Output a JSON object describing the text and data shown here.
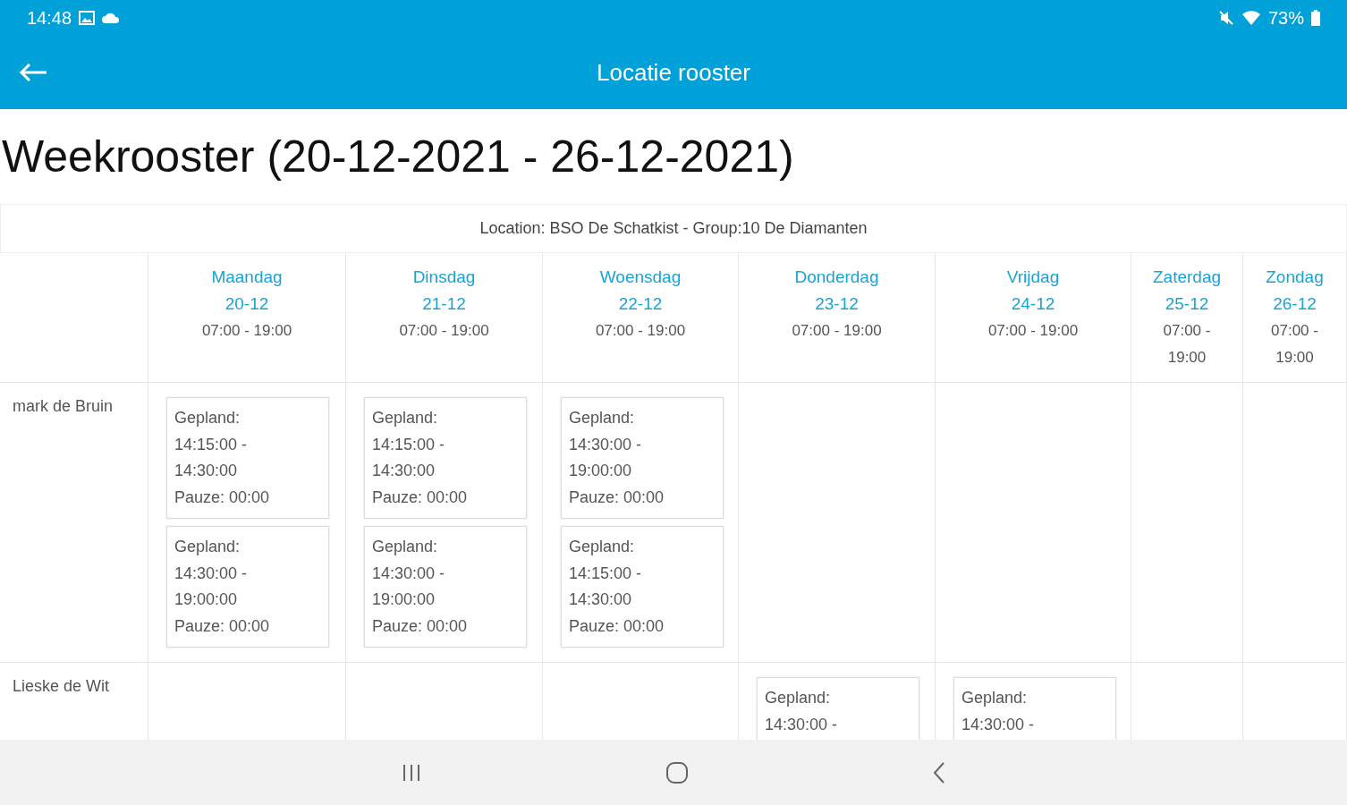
{
  "status_bar": {
    "time": "14:48",
    "battery": "73%"
  },
  "toolbar": {
    "title": "Locatie rooster"
  },
  "heading": "Weekrooster (20-12-2021 - 26-12-2021)",
  "location": "Location: BSO De Schatkist - Group:10 De Diamanten",
  "days": [
    {
      "name": "Maandag",
      "date": "20-12",
      "hours": "07:00 - 19:00"
    },
    {
      "name": "Dinsdag",
      "date": "21-12",
      "hours": "07:00 - 19:00"
    },
    {
      "name": "Woensdag",
      "date": "22-12",
      "hours": "07:00 - 19:00"
    },
    {
      "name": "Donderdag",
      "date": "23-12",
      "hours": "07:00 - 19:00"
    },
    {
      "name": "Vrijdag",
      "date": "24-12",
      "hours": "07:00 - 19:00"
    },
    {
      "name": "Zaterdag",
      "date": "25-12",
      "hours": "07:00 - 19:00"
    },
    {
      "name": "Zondag",
      "date": "26-12",
      "hours": "07:00 - 19:00"
    }
  ],
  "rows": [
    {
      "name": "mark de Bruin",
      "cells": [
        [
          {
            "lines": [
              "Gepland:",
              "14:15:00 -",
              "14:30:00",
              "Pauze: 00:00"
            ]
          },
          {
            "lines": [
              "Gepland:",
              "14:30:00 -",
              "19:00:00",
              "Pauze: 00:00"
            ]
          }
        ],
        [
          {
            "lines": [
              "Gepland:",
              "14:15:00 -",
              "14:30:00",
              "Pauze: 00:00"
            ]
          },
          {
            "lines": [
              "Gepland:",
              "14:30:00 -",
              "19:00:00",
              "Pauze: 00:00"
            ]
          }
        ],
        [
          {
            "lines": [
              "Gepland:",
              "14:30:00 -",
              "19:00:00",
              "Pauze: 00:00"
            ]
          },
          {
            "lines": [
              "Gepland:",
              "14:15:00 -",
              "14:30:00",
              "Pauze: 00:00"
            ]
          }
        ],
        [],
        [],
        [],
        []
      ]
    },
    {
      "name": "Lieske de Wit",
      "cells": [
        [],
        [],
        [],
        [
          {
            "lines": [
              "Gepland:",
              "14:30:00 -"
            ]
          }
        ],
        [
          {
            "lines": [
              "Gepland:",
              "14:30:00 -"
            ]
          }
        ],
        [],
        []
      ]
    }
  ]
}
